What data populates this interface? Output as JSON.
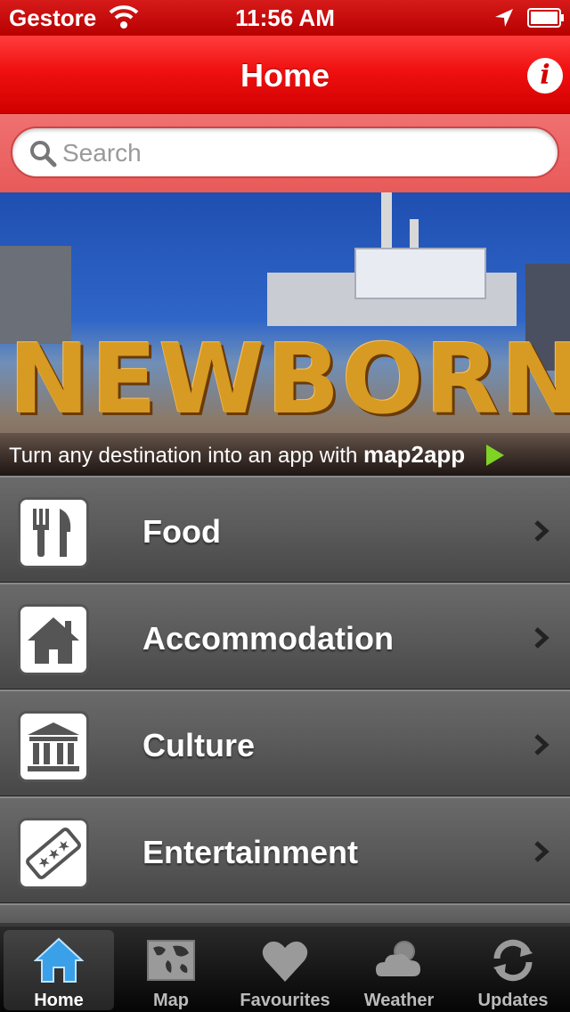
{
  "status_bar": {
    "carrier": "Gestore",
    "time": "11:56 AM",
    "icons": [
      "wifi-icon",
      "location-arrow-icon",
      "battery-icon"
    ]
  },
  "nav_bar": {
    "title": "Home",
    "info_label": "i"
  },
  "search": {
    "placeholder": "Search",
    "value": ""
  },
  "banner": {
    "sign_text": "NEWBORN",
    "tagline": "Turn any destination into an app with ",
    "brand": "map2app"
  },
  "menu": {
    "items": [
      {
        "label": "Food",
        "icon": "fork-knife-icon"
      },
      {
        "label": "Accommodation",
        "icon": "house-icon"
      },
      {
        "label": "Culture",
        "icon": "museum-icon"
      },
      {
        "label": "Entertainment",
        "icon": "ticket-icon"
      }
    ]
  },
  "tab_bar": {
    "tabs": [
      {
        "label": "Home",
        "icon": "home-icon",
        "active": true
      },
      {
        "label": "Map",
        "icon": "world-map-icon",
        "active": false
      },
      {
        "label": "Favourites",
        "icon": "heart-icon",
        "active": false
      },
      {
        "label": "Weather",
        "icon": "weather-icon",
        "active": false
      },
      {
        "label": "Updates",
        "icon": "refresh-icon",
        "active": false
      }
    ]
  },
  "colors": {
    "nav_red": "#e00000",
    "search_bg": "#e85a5a",
    "menu_gray": "#5a5a5a",
    "tab_active_blue": "#3aa0e8",
    "brand_green": "#7fd324"
  }
}
